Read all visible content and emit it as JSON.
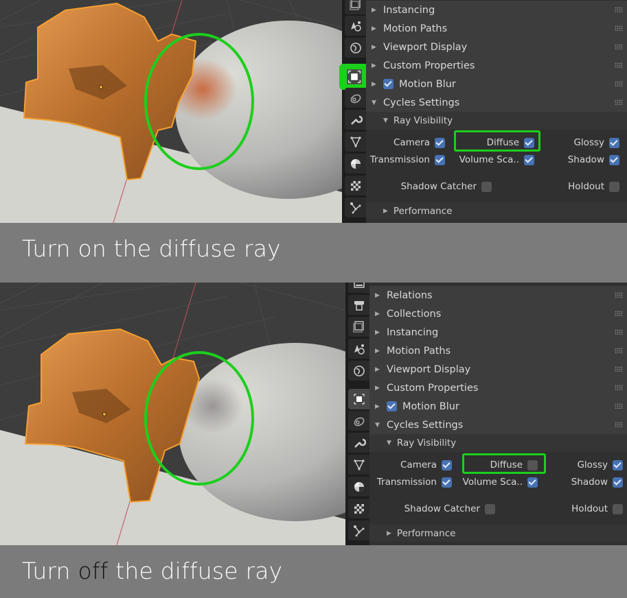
{
  "colors": {
    "highlight_green": "#1ccf1c",
    "checkbox_on": "#4772b3",
    "checkbox_off": "#545454",
    "panel_bg": "#3d3d3d",
    "caption_bg": "#7b7b7b",
    "object_orange": "#c87a33"
  },
  "top": {
    "sidebar_tabs": [
      "image-stack-icon",
      "physics-shapes-icon",
      "world-icon",
      "object-icon",
      "constraint-icon",
      "wrench-icon",
      "mesh-data-icon",
      "material-icon",
      "texture-icon",
      "particles-icon"
    ],
    "active_tab": "object-icon",
    "sections": [
      {
        "label": "Instancing",
        "expanded": false
      },
      {
        "label": "Motion Paths",
        "expanded": false
      },
      {
        "label": "Viewport Display",
        "expanded": false
      },
      {
        "label": "Custom Properties",
        "expanded": false
      },
      {
        "label": "Motion Blur",
        "expanded": false,
        "checkbox": true
      },
      {
        "label": "Cycles Settings",
        "expanded": true
      }
    ],
    "ray_visibility": {
      "title": "Ray Visibility",
      "camera": {
        "label": "Camera",
        "checked": true
      },
      "diffuse": {
        "label": "Diffuse",
        "checked": true
      },
      "glossy": {
        "label": "Glossy",
        "checked": true
      },
      "transmission": {
        "label": "Transmission",
        "checked": true
      },
      "volume": {
        "label": "Volume Sca..",
        "checked": true
      },
      "shadow": {
        "label": "Shadow",
        "checked": true
      },
      "shadow_catcher": {
        "label": "Shadow Catcher",
        "checked": false
      },
      "holdout": {
        "label": "Holdout",
        "checked": false
      }
    },
    "performance": "Performance",
    "caption": "Turn on the diffuse ray"
  },
  "bottom": {
    "sidebar_tabs": [
      "output-icon",
      "printer-icon",
      "image-stack-icon",
      "physics-shapes-icon",
      "world-icon",
      "object-icon",
      "constraint-icon",
      "wrench-icon",
      "mesh-data-icon",
      "material-icon",
      "texture-icon",
      "particles-icon"
    ],
    "active_tab": "object-icon",
    "sections": [
      {
        "label": "Relations",
        "expanded": false
      },
      {
        "label": "Collections",
        "expanded": false
      },
      {
        "label": "Instancing",
        "expanded": false
      },
      {
        "label": "Motion Paths",
        "expanded": false
      },
      {
        "label": "Viewport Display",
        "expanded": false
      },
      {
        "label": "Custom Properties",
        "expanded": false
      },
      {
        "label": "Motion Blur",
        "expanded": false,
        "checkbox": true
      },
      {
        "label": "Cycles Settings",
        "expanded": true
      }
    ],
    "ray_visibility": {
      "title": "Ray Visibility",
      "camera": {
        "label": "Camera",
        "checked": true
      },
      "diffuse": {
        "label": "Diffuse",
        "checked": false
      },
      "glossy": {
        "label": "Glossy",
        "checked": true
      },
      "transmission": {
        "label": "Transmission",
        "checked": true
      },
      "volume": {
        "label": "Volume Sca..",
        "checked": true
      },
      "shadow": {
        "label": "Shadow",
        "checked": true
      },
      "shadow_catcher": {
        "label": "Shadow Catcher",
        "checked": false
      },
      "holdout": {
        "label": "Holdout",
        "checked": false
      }
    },
    "performance": "Performance",
    "caption_parts": [
      "Turn ",
      "off",
      " the diffuse ray"
    ]
  }
}
